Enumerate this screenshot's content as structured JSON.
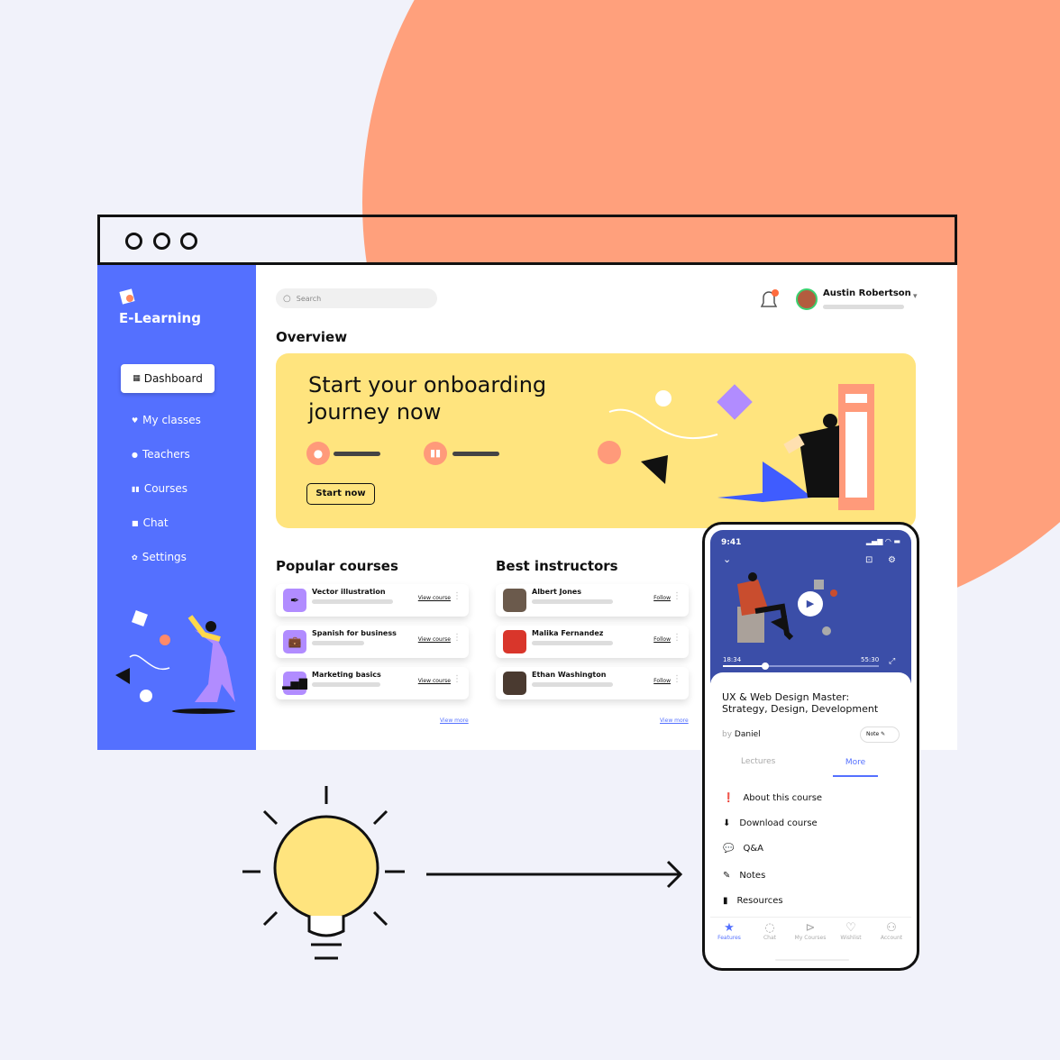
{
  "colors": {
    "accent": "#5470ff",
    "banner": "#ffe47e",
    "circle": "#ffa07c",
    "card_icon": "#b18cff"
  },
  "brand": {
    "name": "E-Learning"
  },
  "sidebar": {
    "items": [
      {
        "label": "Dashboard",
        "icon": "grid-icon"
      },
      {
        "label": "My classes",
        "icon": "heart-icon"
      },
      {
        "label": "Teachers",
        "icon": "user-icon"
      },
      {
        "label": "Courses",
        "icon": "book-icon"
      },
      {
        "label": "Chat",
        "icon": "chat-icon"
      },
      {
        "label": "Settings",
        "icon": "gear-icon"
      }
    ]
  },
  "header": {
    "search_placeholder": "Search",
    "user_name": "Austin Robertson"
  },
  "overview": {
    "title": "Overview",
    "banner_title_1": "Start your onboarding",
    "banner_title_2": "journey now",
    "cta": "Start now"
  },
  "popular": {
    "title": "Popular courses",
    "view_more": "View more",
    "items": [
      {
        "name": "Vector illustration",
        "action": "View course"
      },
      {
        "name": "Spanish for business",
        "action": "View course"
      },
      {
        "name": "Marketing basics",
        "action": "View course"
      }
    ]
  },
  "instructors": {
    "title": "Best instructors",
    "view_more": "View more",
    "items": [
      {
        "name": "Albert Jones",
        "action": "Follow"
      },
      {
        "name": "Malika Fernandez",
        "action": "Follow"
      },
      {
        "name": "Ethan Washington",
        "action": "Follow"
      }
    ]
  },
  "phone": {
    "time": "9:41",
    "elapsed": "18:34",
    "duration": "55:30",
    "progress": 0.27,
    "course_title_1": "UX & Web Design Master:",
    "course_title_2": "Strategy, Design, Development",
    "by": "by",
    "author": "Daniel",
    "note": "Note",
    "tabs": [
      "Lectures",
      "More"
    ],
    "active_tab": "More",
    "menu": [
      "About this course",
      "Download course",
      "Q&A",
      "Notes",
      "Resources"
    ],
    "bottom_nav": [
      "Features",
      "Chat",
      "My Courses",
      "Wishlist",
      "Account"
    ]
  }
}
